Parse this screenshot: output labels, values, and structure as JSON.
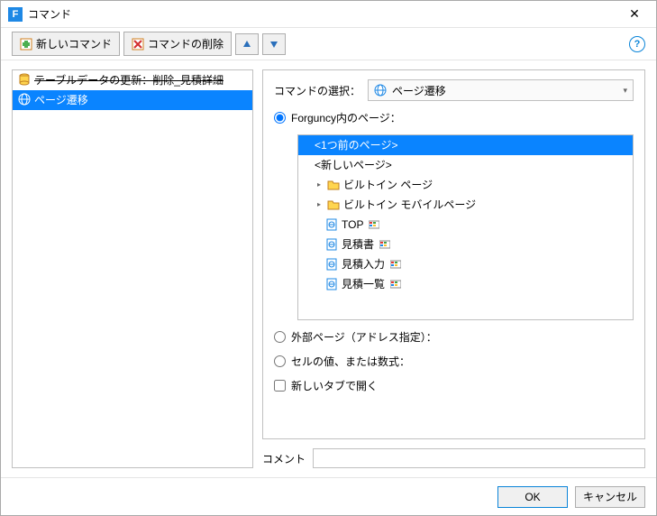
{
  "window": {
    "title": "コマンド"
  },
  "toolbar": {
    "new_cmd": "新しいコマンド",
    "del_cmd": "コマンドの削除"
  },
  "left": {
    "items": [
      {
        "label": "テーブルデータの更新：削除_見積詳細",
        "icon": "db",
        "strike": true,
        "selected": false
      },
      {
        "label": "ページ遷移",
        "icon": "globe",
        "strike": false,
        "selected": true
      }
    ]
  },
  "right": {
    "select_label": "コマンドの選択：",
    "select_value": "ページ遷移",
    "radio1": "Forguncy内のページ：",
    "radio2": "外部ページ（アドレス指定）：",
    "radio3": "セルの値、または数式：",
    "checkbox1": "新しいタブで開く",
    "tree": [
      {
        "label": "<1つ前のページ>",
        "selected": true,
        "indent": 1
      },
      {
        "label": "<新しいページ>",
        "indent": 1
      },
      {
        "label": "ビルトイン ページ",
        "icon": "folder",
        "expander": "▸",
        "indent": 1
      },
      {
        "label": "ビルトイン モバイルページ",
        "icon": "folder",
        "expander": "▸",
        "indent": 1
      },
      {
        "label": "TOP",
        "icon": "page",
        "badge": true,
        "indent": 2
      },
      {
        "label": "見積書",
        "icon": "page",
        "badge": true,
        "indent": 2
      },
      {
        "label": "見積入力",
        "icon": "page",
        "badge": true,
        "indent": 2
      },
      {
        "label": "見積一覧",
        "icon": "page",
        "badge": true,
        "indent": 2
      }
    ]
  },
  "comment": {
    "label": "コメント",
    "value": ""
  },
  "footer": {
    "ok": "OK",
    "cancel": "キャンセル"
  }
}
